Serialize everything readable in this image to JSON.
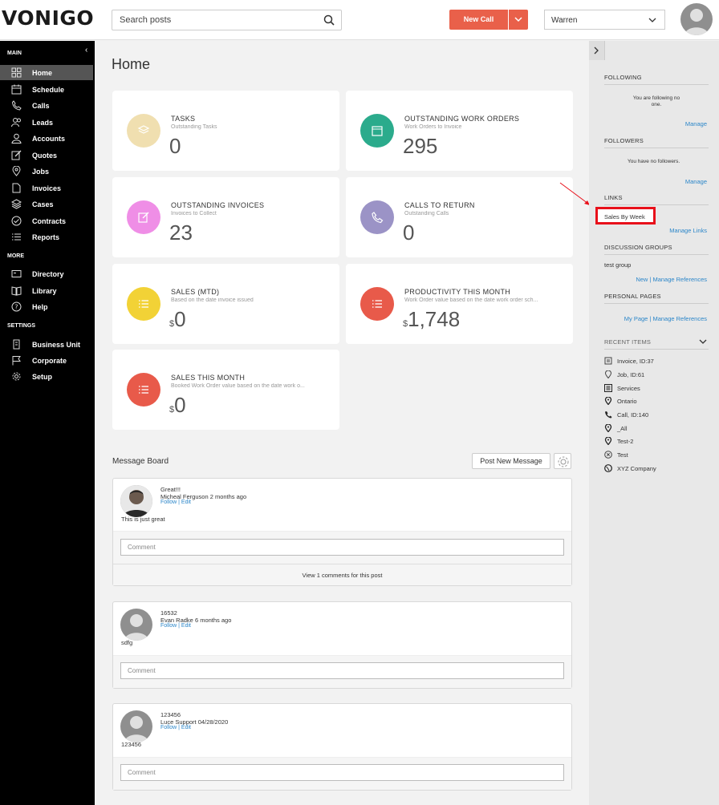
{
  "header": {
    "logo": "VONIGO",
    "search_placeholder": "Search posts",
    "new_call": "New Call",
    "user": "Warren"
  },
  "sidebar": {
    "sections": [
      {
        "label": "MAIN"
      },
      {
        "label": "MORE"
      },
      {
        "label": "SETTINGS"
      }
    ],
    "main_items": [
      {
        "label": "Home",
        "icon": "grid-icon"
      },
      {
        "label": "Schedule",
        "icon": "calendar-icon"
      },
      {
        "label": "Calls",
        "icon": "phone-icon"
      },
      {
        "label": "Leads",
        "icon": "people-icon"
      },
      {
        "label": "Accounts",
        "icon": "person-icon"
      },
      {
        "label": "Quotes",
        "icon": "edit-icon"
      },
      {
        "label": "Jobs",
        "icon": "location-icon"
      },
      {
        "label": "Invoices",
        "icon": "document-icon"
      },
      {
        "label": "Cases",
        "icon": "layers-icon"
      },
      {
        "label": "Contracts",
        "icon": "check-circle-icon"
      },
      {
        "label": "Reports",
        "icon": "list-icon"
      }
    ],
    "more_items": [
      {
        "label": "Directory",
        "icon": "card-icon"
      },
      {
        "label": "Library",
        "icon": "book-icon"
      },
      {
        "label": "Help",
        "icon": "help-icon"
      }
    ],
    "settings_items": [
      {
        "label": "Business Unit",
        "icon": "building-icon"
      },
      {
        "label": "Corporate",
        "icon": "flag-icon"
      },
      {
        "label": "Setup",
        "icon": "gear-icon"
      }
    ]
  },
  "main": {
    "title": "Home",
    "cards": [
      {
        "title": "TASKS",
        "subtitle": "Outstanding Tasks",
        "value": "0",
        "currency": "",
        "color": "#f0dfb0"
      },
      {
        "title": "OUTSTANDING WORK ORDERS",
        "subtitle": "Work Orders to Invoice",
        "value": "295",
        "currency": "",
        "color": "#2bab8c"
      },
      {
        "title": "OUTSTANDING INVOICES",
        "subtitle": "Invoices to Collect",
        "value": "23",
        "currency": "",
        "color": "#ef8ee6"
      },
      {
        "title": "CALLS TO RETURN",
        "subtitle": "Outstanding Calls",
        "value": "0",
        "currency": "",
        "color": "#9b93c6"
      },
      {
        "title": "SALES (MTD)",
        "subtitle": "Based on the date invoice issued",
        "value": "0",
        "currency": "$",
        "color": "#f2d236"
      },
      {
        "title": "PRODUCTIVITY THIS MONTH",
        "subtitle": "Work Order value based on the date work order sch...",
        "value": "1,748",
        "currency": "$",
        "color": "#e85a4a"
      },
      {
        "title": "SALES THIS MONTH",
        "subtitle": "Booked Work Order value based on the date work o...",
        "value": "0",
        "currency": "$",
        "color": "#e85a4a"
      }
    ],
    "message_board": {
      "title": "Message Board",
      "post_new": "Post New Message",
      "comment_placeholder": "Comment",
      "posts": [
        {
          "title": "Great!!!",
          "author": "Micheal Ferguson 2 months ago",
          "links": "Follow | Edit",
          "body": "This is just great",
          "view_comments": "View 1 comments for this post"
        },
        {
          "title": "16532",
          "author": "Evan Radke 6 months ago",
          "links": "Follow | Edit",
          "body": "sdfg"
        },
        {
          "title": "123456",
          "author": "Luce Support 04/28/2020",
          "links": "Follow | Edit",
          "body": "123456"
        }
      ]
    }
  },
  "right_panel": {
    "following": {
      "header": "FOLLOWING",
      "text": "You are following no one.",
      "link": "Manage"
    },
    "followers": {
      "header": "FOLLOWERS",
      "text": "You have no followers.",
      "link": "Manage"
    },
    "links": {
      "header": "LINKS",
      "item": "Sales By Week",
      "link": "Manage Links"
    },
    "discussion": {
      "header": "DISCUSSION GROUPS",
      "item": "test group",
      "link": "New | Manage References"
    },
    "personal": {
      "header": "PERSONAL PAGES",
      "link": "My Page | Manage References"
    },
    "recent": {
      "header": "RECENT ITEMS",
      "items": [
        {
          "label": "Invoice, ID:37",
          "icon": "invoice-icon"
        },
        {
          "label": "Job, ID:61",
          "icon": "location-icon"
        },
        {
          "label": "Services",
          "icon": "list-box-icon"
        },
        {
          "label": "Ontario",
          "icon": "pin-icon"
        },
        {
          "label": "Call, ID:140",
          "icon": "phone-icon"
        },
        {
          "label": "_All",
          "icon": "pin-icon"
        },
        {
          "label": "Test-2",
          "icon": "pin-icon"
        },
        {
          "label": "Test",
          "icon": "x-circle-icon"
        },
        {
          "label": "XYZ Company",
          "icon": "globe-icon"
        }
      ]
    }
  },
  "colors": {
    "accent": "#e9604a",
    "link": "#2b86c9",
    "highlight": "#e8101a"
  }
}
